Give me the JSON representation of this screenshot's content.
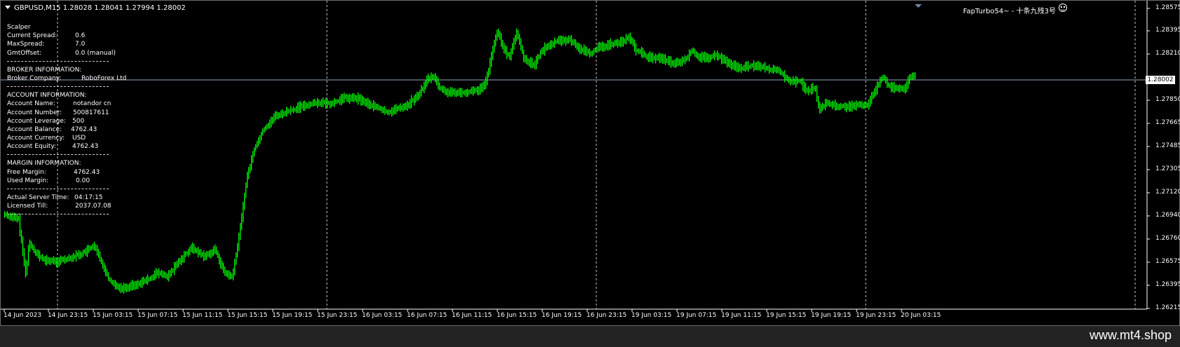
{
  "chart": {
    "header": "GBPUSD,M15  1.28028 1.28041 1.27994 1.28002",
    "ea_label": "FapTurbo54~ - 十条九残3号",
    "current_price": "1.28002",
    "price_ticks": [
      "1.28575",
      "1.28395",
      "1.28210",
      "1.28002",
      "1.27850",
      "1.27665",
      "1.27485",
      "1.27305",
      "1.27120",
      "1.26940",
      "1.26760",
      "1.26575",
      "1.26395",
      "1.26215"
    ],
    "time_ticks": [
      "14 Jun 2023",
      "14 Jun 23:15",
      "15 Jun 03:15",
      "15 Jun 07:15",
      "15 Jun 11:15",
      "15 Jun 15:15",
      "15 Jun 19:15",
      "15 Jun 23:15",
      "16 Jun 03:15",
      "16 Jun 07:15",
      "16 Jun 11:15",
      "16 Jun 15:15",
      "16 Jun 19:15",
      "16 Jun 23:15",
      "19 Jun 03:15",
      "19 Jun 07:15",
      "19 Jun 11:15",
      "19 Jun 15:15",
      "19 Jun 19:15",
      "19 Jun 23:15",
      "20 Jun 03:15"
    ],
    "bull_color": "#00ff00",
    "background": "#000000"
  },
  "info": {
    "title": "Scalper",
    "rows": [
      {
        "label": "Current Spread:",
        "value": "0.6"
      },
      {
        "label": "MaxSpread:",
        "value": "7.0"
      },
      {
        "label": "GmtOffset:",
        "value": "0.0 (manual)"
      }
    ],
    "broker_header": "BROKER INFORMATION:",
    "broker_label": "Broker Company:",
    "broker_value": "RoboForex Ltd",
    "account_header": "ACCOUNT INFORMATION:",
    "account_rows": [
      {
        "label": "Account Name:",
        "value": "notandor cn"
      },
      {
        "label": "Account Number:",
        "value": "500817611"
      },
      {
        "label": "Account Leverage:",
        "value": "500"
      },
      {
        "label": "Account Balance:",
        "value": "4762.43"
      },
      {
        "label": "Account Currency:",
        "value": "USD"
      },
      {
        "label": "Account Equity:",
        "value": "4762.43"
      }
    ],
    "margin_header": "MARGIN INFORMATION:",
    "margin_rows": [
      {
        "label": "Free Margin:",
        "value": "4762.43"
      },
      {
        "label": "Used Margin:",
        "value": "0.00"
      }
    ],
    "time_rows": [
      {
        "label": "Actual Server Time:",
        "value": "04:17:15"
      },
      {
        "label": "Licensed Till:",
        "value": "2037.07.08"
      }
    ]
  },
  "watermark": "www.mt4.shop"
}
